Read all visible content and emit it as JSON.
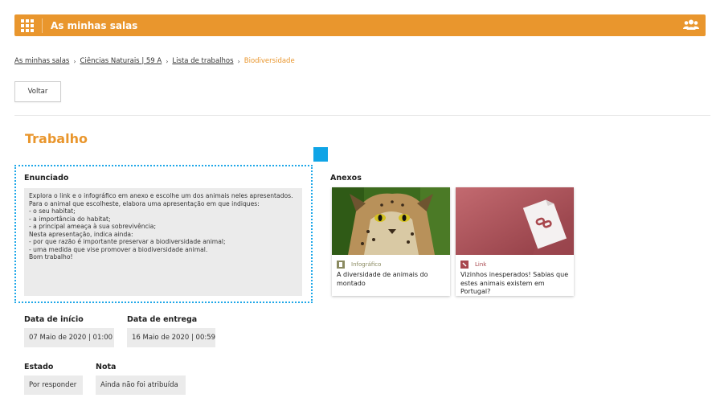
{
  "header": {
    "title": "As minhas salas",
    "grid_icon": "apps-grid-icon",
    "users_icon": "users-group-icon"
  },
  "breadcrumb": {
    "items": [
      "As minhas salas",
      "Ciências Naturais | 59 A",
      "Lista de trabalhos"
    ],
    "current": "Biodiversidade",
    "separator": "›"
  },
  "back_button": {
    "label": "Voltar"
  },
  "section_title": "Trabalho",
  "enunciado": {
    "label": "Enunciado",
    "lines": [
      "Explora o link e o infográfico em anexo e escolhe um dos animais neles apresentados.",
      "Para o animal que escolheste, elabora uma apresentação em que indiques:",
      "- o seu habitat;",
      "- a importância do habitat;",
      "- a principal ameaça à sua sobrevivência;",
      "Nesta apresentação, indica ainda:",
      "- por que razão é importante preservar a biodiversidade animal;",
      "- uma medida que vise promover a biodiversidade animal.",
      "Bom trabalho!"
    ]
  },
  "anexos": {
    "label": "Anexos",
    "items": [
      {
        "type": "Infográfico",
        "title": "A diversidade de animais do montado",
        "type_color": "#8a8a60"
      },
      {
        "type": "Link",
        "title": "Vizinhos inesperados! Sabias que estes animais existem em Portugal?",
        "type_color": "#a8474d"
      }
    ]
  },
  "dates": {
    "start_label": "Data de início",
    "start_value": "07 Maio de 2020 | 01:00",
    "due_label": "Data de entrega",
    "due_value": "16 Maio de 2020 | 00:59"
  },
  "status": {
    "state_label": "Estado",
    "state_value": "Por responder",
    "grade_label": "Nota",
    "grade_value": "Ainda não foi atribuída"
  },
  "colors": {
    "accent": "#e9962d",
    "selection": "#1ea7e8",
    "field_bg": "#ebebeb"
  }
}
